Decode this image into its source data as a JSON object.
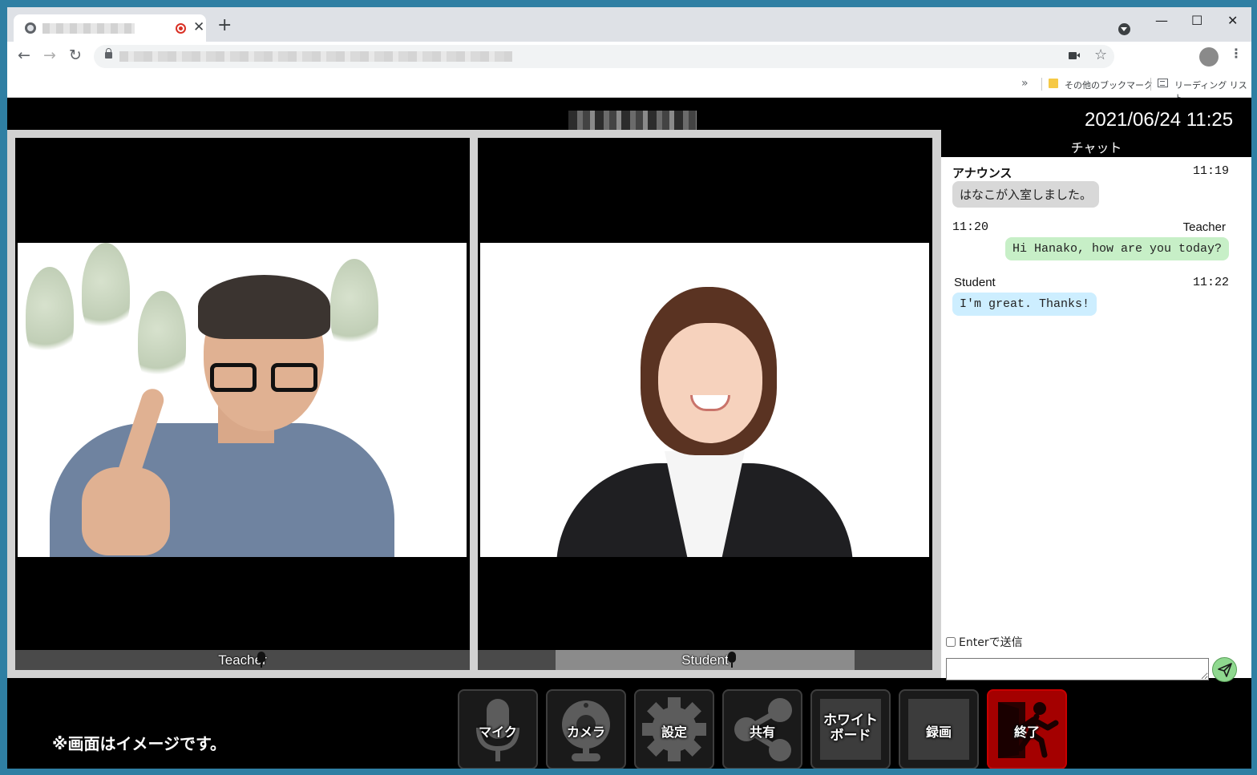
{
  "browser": {
    "new_tab_label": "+",
    "close_tab_label": "✕",
    "window_controls": {
      "minimize": "—",
      "maximize": "☐",
      "close": "✕"
    },
    "nav": {
      "back": "←",
      "forward": "→",
      "reload": "↻"
    },
    "star": "☆",
    "menu": "⋮",
    "bookmarks_overflow": "»",
    "bookmarks_other": "その他のブックマーク",
    "reading_list": "リーディング リスト"
  },
  "header": {
    "datetime": "2021/06/24 11:25"
  },
  "videos": [
    {
      "label": "Teacher"
    },
    {
      "label": "Student"
    }
  ],
  "chat": {
    "title": "チャット",
    "messages": [
      {
        "sender": "アナウンス",
        "time": "11:19",
        "text": "はなこが入室しました。",
        "type": "announce"
      },
      {
        "sender": "Teacher",
        "time": "11:20",
        "text": "Hi Hanako, how are you today?",
        "type": "mine"
      },
      {
        "sender": "Student",
        "time": "11:22",
        "text": "I'm great. Thanks!",
        "type": "theirs"
      }
    ],
    "enter_to_send_label": "Enterで送信",
    "input_value": ""
  },
  "controls": {
    "mic": "マイク",
    "camera": "カメラ",
    "settings": "設定",
    "share": "共有",
    "whiteboard_line1": "ホワイト",
    "whiteboard_line2": "ボード",
    "record": "録画",
    "end": "終了"
  },
  "notice": "※画面はイメージです。",
  "icons": {
    "tab": "globe-icon",
    "recording": "record-icon",
    "send": "paper-plane-icon",
    "end": "exit-door-icon"
  }
}
